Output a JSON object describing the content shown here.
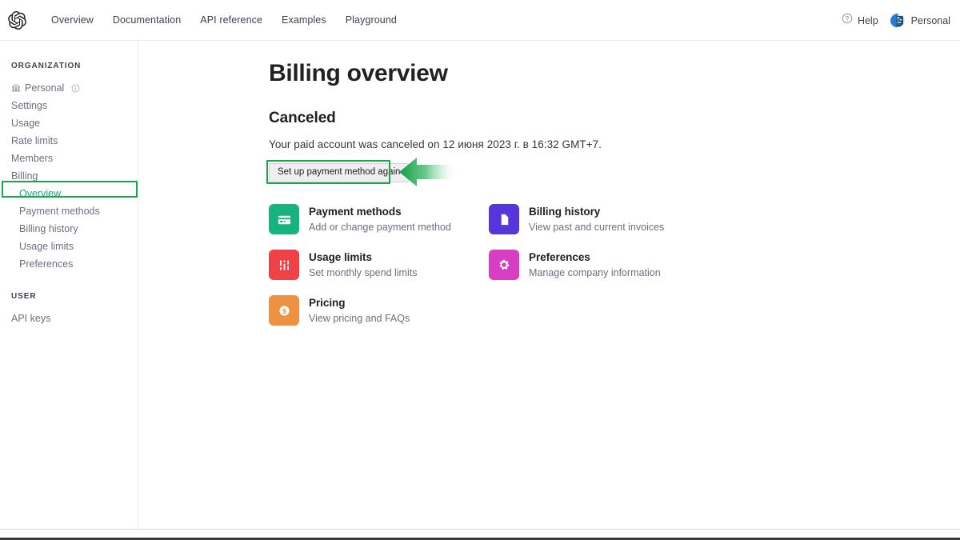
{
  "header": {
    "logo_icon": "openai-logo-icon",
    "nav": [
      {
        "label": "Overview"
      },
      {
        "label": "Documentation"
      },
      {
        "label": "API reference"
      },
      {
        "label": "Examples"
      },
      {
        "label": "Playground"
      }
    ],
    "help_label": "Help",
    "help_icon": "question-circle-icon",
    "account_label": "Personal",
    "avatar_icon": "user-avatar"
  },
  "sidebar": {
    "org_section_title": "ORGANIZATION",
    "org_items": [
      {
        "label": "Personal",
        "icon": "bank-icon",
        "trailing_icon": "info-circle-icon",
        "active": false
      },
      {
        "label": "Settings",
        "active": false
      },
      {
        "label": "Usage",
        "active": false
      },
      {
        "label": "Rate limits",
        "active": false
      },
      {
        "label": "Members",
        "active": false
      },
      {
        "label": "Billing",
        "active": false
      }
    ],
    "billing_subitems": [
      {
        "label": "Overview",
        "active": true
      },
      {
        "label": "Payment methods",
        "active": false
      },
      {
        "label": "Billing history",
        "active": false
      },
      {
        "label": "Usage limits",
        "active": false
      },
      {
        "label": "Preferences",
        "active": false
      }
    ],
    "user_section_title": "USER",
    "user_items": [
      {
        "label": "API keys",
        "active": false
      }
    ]
  },
  "main": {
    "page_title": "Billing overview",
    "status_title": "Canceled",
    "status_description": "Your paid account was canceled on 12 июня 2023 г. в 16:32 GMT+7.",
    "cta_label": "Set up payment method again",
    "cards": [
      {
        "title": "Payment methods",
        "subtitle": "Add or change payment method",
        "icon": "credit-card-icon",
        "color": "#16b37f"
      },
      {
        "title": "Billing history",
        "subtitle": "View past and current invoices",
        "icon": "document-icon",
        "color": "#5436da"
      },
      {
        "title": "Usage limits",
        "subtitle": "Set monthly spend limits",
        "icon": "sliders-icon",
        "color": "#ef4146"
      },
      {
        "title": "Preferences",
        "subtitle": "Manage company information",
        "icon": "gear-icon",
        "color": "#d83ec2"
      },
      {
        "title": "Pricing",
        "subtitle": "View pricing and FAQs",
        "icon": "dollar-coin-icon",
        "color": "#ef9143"
      }
    ]
  },
  "annotations": {
    "highlight_color": "#17a84a",
    "arrow_icon": "left-arrow-annotation"
  }
}
